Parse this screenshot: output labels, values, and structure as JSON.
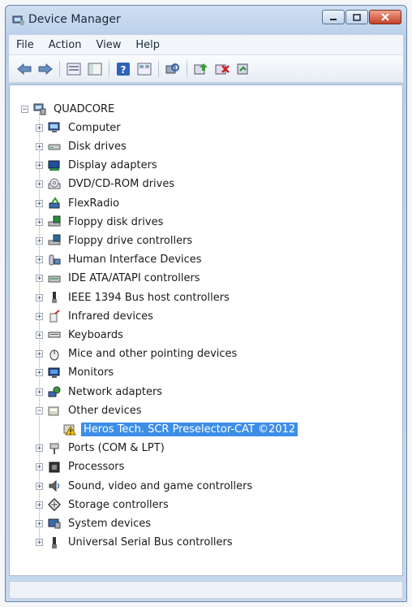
{
  "window": {
    "title": "Device Manager"
  },
  "menu": [
    "File",
    "Action",
    "View",
    "Help"
  ],
  "toolbar_icons": [
    "back-icon",
    "forward-icon",
    "properties-icon",
    "show-hide-console-tree-icon",
    "help-icon",
    "view-icon",
    "scan-hardware-icon",
    "update-driver-icon",
    "uninstall-icon",
    "disable-icon"
  ],
  "tree": {
    "root": "QUADCORE",
    "categories": [
      {
        "label": "Computer",
        "icon": "computer-icon",
        "expanded": false
      },
      {
        "label": "Disk drives",
        "icon": "disk-drive-icon",
        "expanded": false
      },
      {
        "label": "Display adapters",
        "icon": "display-adapter-icon",
        "expanded": false
      },
      {
        "label": "DVD/CD-ROM drives",
        "icon": "dvd-drive-icon",
        "expanded": false
      },
      {
        "label": "FlexRadio",
        "icon": "flexradio-icon",
        "expanded": false
      },
      {
        "label": "Floppy disk drives",
        "icon": "floppy-drive-icon",
        "expanded": false
      },
      {
        "label": "Floppy drive controllers",
        "icon": "floppy-controller-icon",
        "expanded": false
      },
      {
        "label": "Human Interface Devices",
        "icon": "hid-icon",
        "expanded": false
      },
      {
        "label": "IDE ATA/ATAPI controllers",
        "icon": "ide-controller-icon",
        "expanded": false
      },
      {
        "label": "IEEE 1394 Bus host controllers",
        "icon": "ieee1394-icon",
        "expanded": false
      },
      {
        "label": "Infrared devices",
        "icon": "infrared-icon",
        "expanded": false
      },
      {
        "label": "Keyboards",
        "icon": "keyboard-icon",
        "expanded": false
      },
      {
        "label": "Mice and other pointing devices",
        "icon": "mouse-icon",
        "expanded": false
      },
      {
        "label": "Monitors",
        "icon": "monitor-icon",
        "expanded": false
      },
      {
        "label": "Network adapters",
        "icon": "network-adapter-icon",
        "expanded": false
      },
      {
        "label": "Other devices",
        "icon": "other-devices-icon",
        "expanded": true,
        "children": [
          {
            "label": "Heros Tech. SCR Preselector-CAT ©2012",
            "icon": "warning-device-icon",
            "selected": true
          }
        ]
      },
      {
        "label": "Ports (COM & LPT)",
        "icon": "port-icon",
        "expanded": false
      },
      {
        "label": "Processors",
        "icon": "processor-icon",
        "expanded": false
      },
      {
        "label": "Sound, video and game controllers",
        "icon": "sound-icon",
        "expanded": false
      },
      {
        "label": "Storage controllers",
        "icon": "storage-icon",
        "expanded": false
      },
      {
        "label": "System devices",
        "icon": "system-devices-icon",
        "expanded": false
      },
      {
        "label": "Universal Serial Bus controllers",
        "icon": "usb-icon",
        "expanded": false
      }
    ]
  },
  "colors": {
    "selection": "#3c8ee6",
    "title_bar": "#c3d6ee",
    "close_button": "#d0533a"
  }
}
